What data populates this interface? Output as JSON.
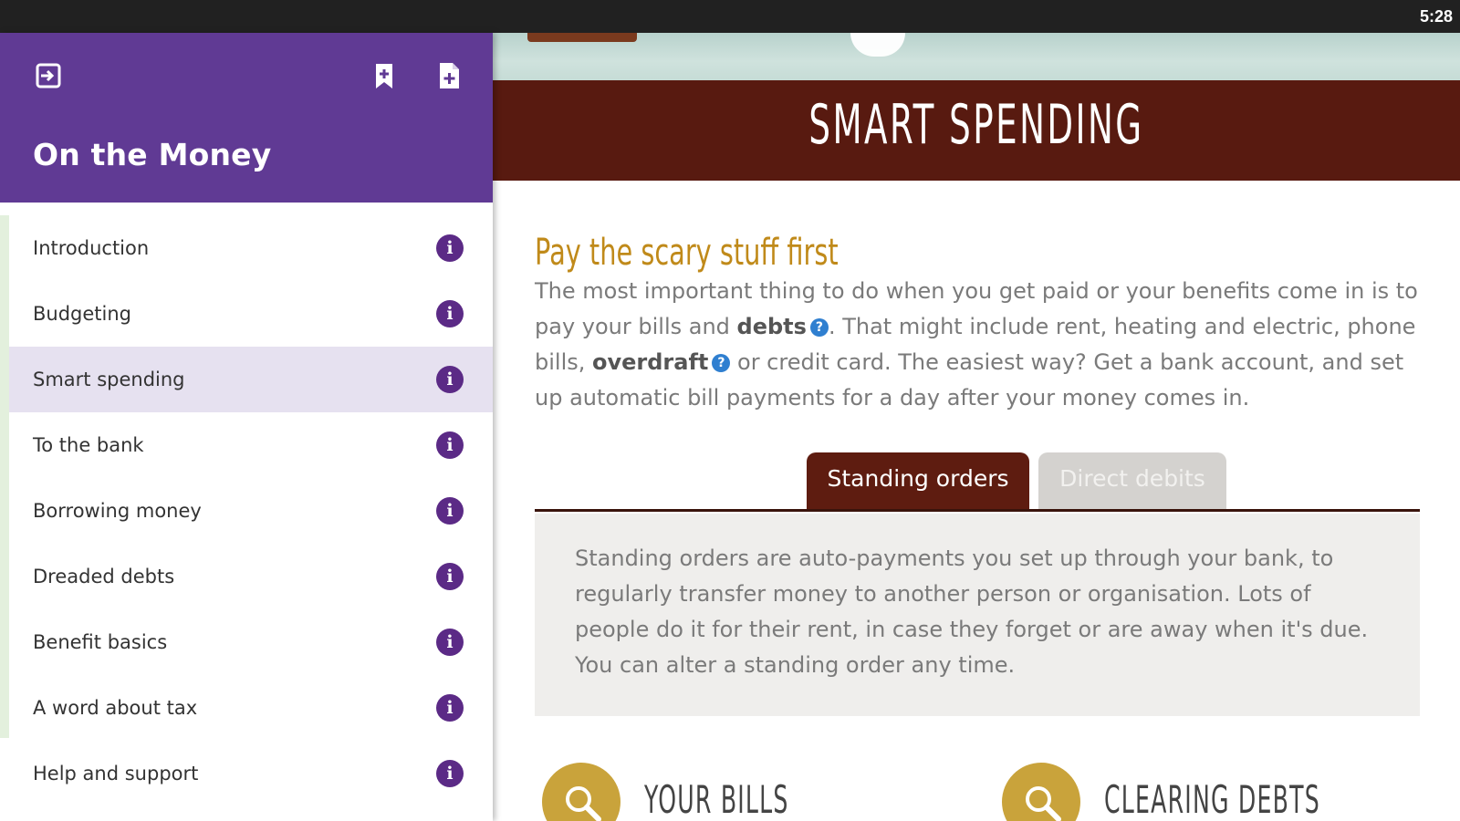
{
  "status_bar": {
    "time": "5:28"
  },
  "drawer": {
    "title": "On the Money",
    "icons": {
      "exit": "exit-icon",
      "bookmark": "bookmark-add-icon",
      "note": "note-add-icon"
    },
    "accent_color": "#603a94",
    "items": [
      {
        "label": "Introduction",
        "active": false
      },
      {
        "label": "Budgeting",
        "active": false
      },
      {
        "label": "Smart spending",
        "active": true
      },
      {
        "label": "To the bank",
        "active": false
      },
      {
        "label": "Borrowing money",
        "active": false
      },
      {
        "label": "Dreaded debts",
        "active": false
      },
      {
        "label": "Benefit basics",
        "active": false
      },
      {
        "label": "A word about tax",
        "active": false
      },
      {
        "label": "Help and support",
        "active": false
      }
    ],
    "info_glyph": "i"
  },
  "main": {
    "banner_title": "SMART SPENDING",
    "banner_color": "#581a10",
    "heading": "Pay the scary stuff first",
    "heading_color": "#c08a1a",
    "intro": {
      "part1": "The most important thing to do when you get paid or your benefits come in is to pay your bills and ",
      "term1": "debts",
      "part2": ". That might include rent, heating and electric, phone bills, ",
      "term2": "overdraft",
      "part3": " or credit card. The easiest way? Get a bank account, and set up automatic bill payments for a day after your money comes in.",
      "help_glyph": "?"
    },
    "tabs": [
      {
        "label": "Standing orders",
        "active": true
      },
      {
        "label": "Direct debits",
        "active": false
      }
    ],
    "tab_panel_text": "Standing orders are auto-payments you set up through your bank, to regularly transfer money to another person or organisation. Lots of people do it for their rent, in case they forget or are away when it's due. You can alter a standing order any time.",
    "cards": [
      {
        "label": "YOUR BILLS",
        "icon": "search-icon"
      },
      {
        "label": "CLEARING DEBTS",
        "icon": "search-icon"
      }
    ]
  }
}
